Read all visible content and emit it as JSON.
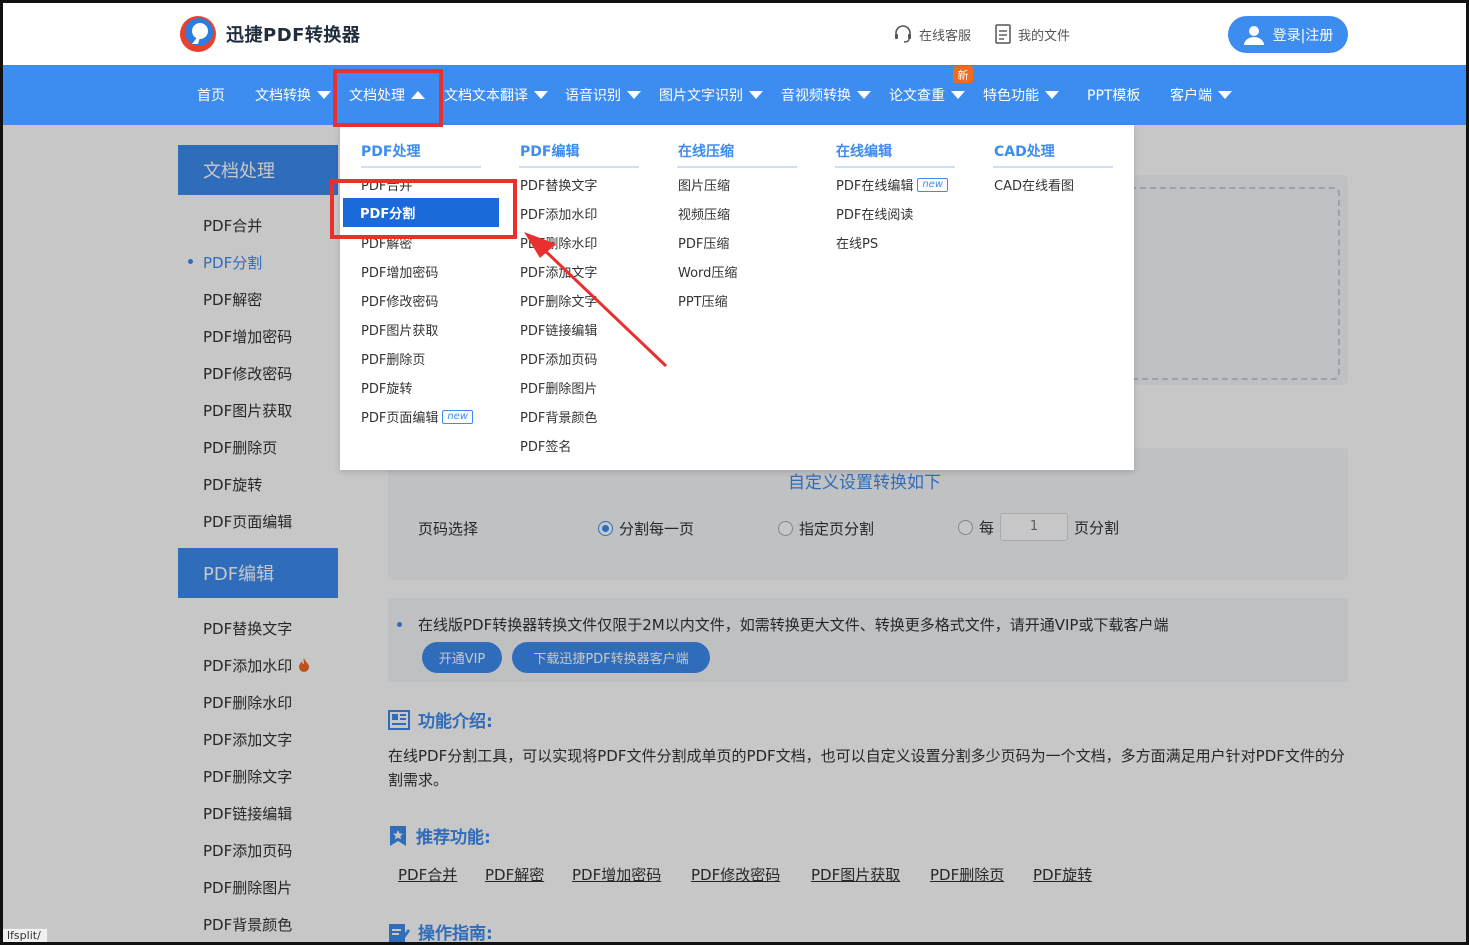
{
  "header": {
    "brand": "迅捷PDF转换器",
    "service": "在线客服",
    "my_files": "我的文件",
    "login": "登录|注册"
  },
  "nav": {
    "items": [
      {
        "label": "首页"
      },
      {
        "label": "文档转换"
      },
      {
        "label": "文档处理"
      },
      {
        "label": "文档文本翻译"
      },
      {
        "label": "语音识别"
      },
      {
        "label": "图片文字识别"
      },
      {
        "label": "音视频转换"
      },
      {
        "label": "论文查重"
      },
      {
        "label": "特色功能"
      },
      {
        "label": "PPT模板"
      },
      {
        "label": "客户端"
      }
    ],
    "new_badge": "新"
  },
  "menu": {
    "columns": [
      {
        "title": "PDF处理",
        "items": [
          "PDF合并",
          "PDF分割",
          "PDF解密",
          "PDF增加密码",
          "PDF修改密码",
          "PDF图片获取",
          "PDF删除页",
          "PDF旋转",
          "PDF页面编辑"
        ]
      },
      {
        "title": "PDF编辑",
        "items": [
          "PDF替换文字",
          "PDF添加水印",
          "PDF删除水印",
          "PDF添加文字",
          "PDF删除文字",
          "PDF链接编辑",
          "PDF添加页码",
          "PDF删除图片",
          "PDF背景颜色",
          "PDF签名"
        ]
      },
      {
        "title": "在线压缩",
        "items": [
          "图片压缩",
          "视频压缩",
          "PDF压缩",
          "Word压缩",
          "PPT压缩"
        ]
      },
      {
        "title": "在线编辑",
        "items": [
          "PDF在线编辑",
          "PDF在线阅读",
          "在线PS"
        ]
      },
      {
        "title": "CAD处理",
        "items": [
          "CAD在线看图"
        ]
      }
    ],
    "new_tag": "new"
  },
  "sidebar": {
    "group1": "文档处理",
    "group1_items": [
      "PDF合并",
      "PDF分割",
      "PDF解密",
      "PDF增加密码",
      "PDF修改密码",
      "PDF图片获取",
      "PDF删除页",
      "PDF旋转",
      "PDF页面编辑"
    ],
    "group2": "PDF编辑",
    "group2_items": [
      "PDF替换文字",
      "PDF添加水印",
      "PDF删除水印",
      "PDF添加文字",
      "PDF删除文字",
      "PDF链接编辑",
      "PDF添加页码",
      "PDF删除图片",
      "PDF背景颜色"
    ]
  },
  "settings": {
    "title": "自定义设置转换如下",
    "label": "页码选择",
    "opt1": "分割每一页",
    "opt2": "指定页分割",
    "opt3_prefix": "每",
    "opt3_value": "1",
    "opt3_suffix": "页分割"
  },
  "notice": {
    "text": "在线版PDF转换器转换文件仅限于2M以内文件，如需转换更大文件、转换更多格式文件，请开通VIP或下载客户端",
    "vip": "开通VIP",
    "download": "下载迅捷PDF转换器客户端"
  },
  "intro": {
    "title": "功能介绍:",
    "text": "在线PDF分割工具，可以实现将PDF文件分割成单页的PDF文档，也可以自定义设置分割多少页码为一个文档，多方面满足用户针对PDF文件的分割需求。"
  },
  "recommend": {
    "title": "推荐功能:",
    "links": [
      "PDF合并",
      "PDF解密",
      "PDF增加密码",
      "PDF修改密码",
      "PDF图片获取",
      "PDF删除页",
      "PDF旋转"
    ]
  },
  "guide": {
    "title": "操作指南:"
  },
  "status_url": "lfsplit/",
  "colors": {
    "primary": "#3d8cf0",
    "highlight": "#ea2f2f",
    "badge": "#f26b1d"
  }
}
